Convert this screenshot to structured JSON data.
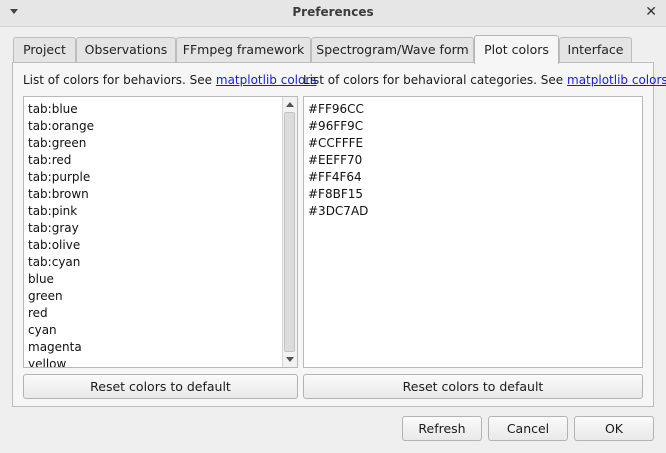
{
  "window": {
    "title": "Preferences",
    "close_glyph": "✕"
  },
  "tabs": [
    {
      "label": "Project"
    },
    {
      "label": "Observations"
    },
    {
      "label": "FFmpeg framework"
    },
    {
      "label": "Spectrogram/Wave form"
    },
    {
      "label": "Plot colors"
    },
    {
      "label": "Interface"
    }
  ],
  "active_tab": "Plot colors",
  "behaviors": {
    "caption": "List of colors for behaviors. See",
    "link": "matplotlib colors",
    "colors": [
      "tab:blue",
      "tab:orange",
      "tab:green",
      "tab:red",
      "tab:purple",
      "tab:brown",
      "tab:pink",
      "tab:gray",
      "tab:olive",
      "tab:cyan",
      "blue",
      "green",
      "red",
      "cyan",
      "magenta",
      "yellow"
    ],
    "reset_label": "Reset colors to default"
  },
  "categories": {
    "caption": "List of colors for behavioral categories. See",
    "link": "matplotlib colors",
    "colors": [
      "#FF96CC",
      "#96FF9C",
      "#CCFFFE",
      "#EEFF70",
      "#FF4F64",
      "#F8BF15",
      "#3DC7AD"
    ],
    "reset_label": "Reset colors to default"
  },
  "footer": {
    "refresh_label": "Refresh",
    "cancel_label": "Cancel",
    "ok_label": "OK"
  },
  "icons": {
    "window_menu": "menu-arrow-icon",
    "close": "close-icon",
    "scroll_up": "arrow-up-icon",
    "scroll_down": "arrow-down-icon"
  }
}
